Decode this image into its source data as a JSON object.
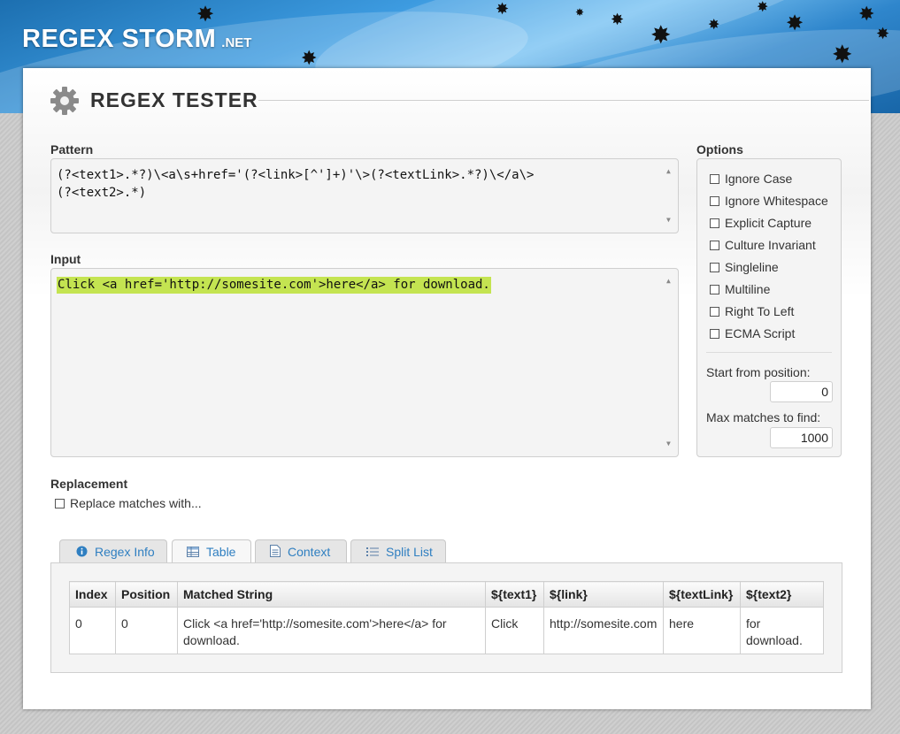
{
  "site": {
    "name": "REGEX STORM",
    "tld": ".NET"
  },
  "tool_title": "REGEX TESTER",
  "pattern": {
    "label": "Pattern",
    "lines": [
      "(?<text1>.*?)\\<a\\s+href='(?<link>[^']+)'\\>(?<textLink>.*?)\\</a\\>",
      "(?<text2>.*)"
    ]
  },
  "input": {
    "label": "Input",
    "value": "Click <a href='http://somesite.com'>here</a> for download."
  },
  "options": {
    "label": "Options",
    "items": [
      {
        "label": "Ignore Case",
        "checked": false
      },
      {
        "label": "Ignore Whitespace",
        "checked": false
      },
      {
        "label": "Explicit Capture",
        "checked": false
      },
      {
        "label": "Culture Invariant",
        "checked": false
      },
      {
        "label": "Singleline",
        "checked": false
      },
      {
        "label": "Multiline",
        "checked": false
      },
      {
        "label": "Right To Left",
        "checked": false
      },
      {
        "label": "ECMA Script",
        "checked": false
      }
    ],
    "start_label": "Start from position:",
    "start_value": "0",
    "max_label": "Max matches to find:",
    "max_value": "1000"
  },
  "replacement": {
    "label": "Replacement",
    "checkbox_label": "Replace matches with..."
  },
  "tabs": [
    {
      "label": "Regex Info",
      "icon": "info-icon",
      "active": false
    },
    {
      "label": "Table",
      "icon": "table-icon",
      "active": true
    },
    {
      "label": "Context",
      "icon": "document-icon",
      "active": false
    },
    {
      "label": "Split List",
      "icon": "list-icon",
      "active": false
    }
  ],
  "table": {
    "headers": [
      "Index",
      "Position",
      "Matched String",
      "${text1}",
      "${link}",
      "${textLink}",
      "${text2}"
    ],
    "rows": [
      [
        "0",
        "0",
        "Click <a href='http://somesite.com'>here</a> for download.",
        "Click",
        "http://somesite.com",
        "here",
        "for download."
      ]
    ]
  },
  "colors": {
    "highlight": "#c4e451",
    "link": "#2f7fc1",
    "banner": "#3d9be0"
  }
}
